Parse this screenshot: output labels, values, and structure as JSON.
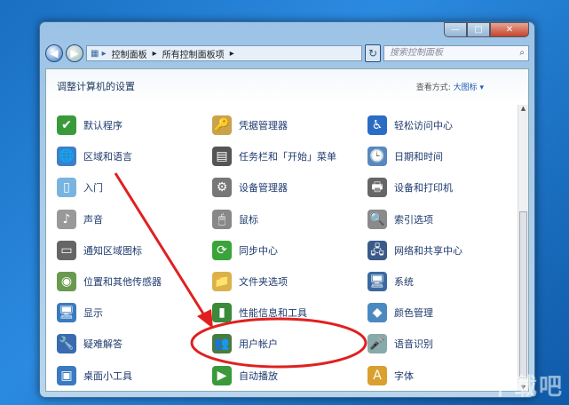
{
  "window": {
    "minimize": "—",
    "maximize": "□",
    "close": "✕"
  },
  "nav": {
    "back": "◀",
    "forward": "▶",
    "breadcrumb": [
      "控制面板",
      "所有控制面板项"
    ],
    "refresh": "↻",
    "search_placeholder": "搜索控制面板"
  },
  "header": {
    "title": "调整计算机的设置",
    "view_label": "查看方式:",
    "view_value": "大图标 ▾"
  },
  "items": [
    {
      "label": "默认程序",
      "icon": "default-programs-icon",
      "color": "#3a9a3a",
      "glyph": "✔"
    },
    {
      "label": "凭据管理器",
      "icon": "credential-manager-icon",
      "color": "#c9a24a",
      "glyph": "🔑"
    },
    {
      "label": "轻松访问中心",
      "icon": "ease-of-access-icon",
      "color": "#2b6cc4",
      "glyph": "♿"
    },
    {
      "label": "区域和语言",
      "icon": "region-language-icon",
      "color": "#3f7ec9",
      "glyph": "🌐"
    },
    {
      "label": "任务栏和「开始」菜单",
      "icon": "taskbar-icon",
      "color": "#555",
      "glyph": "▤"
    },
    {
      "label": "日期和时间",
      "icon": "date-time-icon",
      "color": "#5a86c0",
      "glyph": "🕒"
    },
    {
      "label": "入门",
      "icon": "getting-started-icon",
      "color": "#79b4e0",
      "glyph": "▯"
    },
    {
      "label": "设备管理器",
      "icon": "device-manager-icon",
      "color": "#777",
      "glyph": "⚙"
    },
    {
      "label": "设备和打印机",
      "icon": "devices-printers-icon",
      "color": "#666",
      "glyph": "🖶"
    },
    {
      "label": "声音",
      "icon": "sound-icon",
      "color": "#999",
      "glyph": "♪"
    },
    {
      "label": "鼠标",
      "icon": "mouse-icon",
      "color": "#888",
      "glyph": "🖱"
    },
    {
      "label": "索引选项",
      "icon": "indexing-icon",
      "color": "#8a8a8a",
      "glyph": "🔍"
    },
    {
      "label": "通知区域图标",
      "icon": "notification-icons-icon",
      "color": "#666",
      "glyph": "▭"
    },
    {
      "label": "同步中心",
      "icon": "sync-center-icon",
      "color": "#3aa33a",
      "glyph": "⟳"
    },
    {
      "label": "网络和共享中心",
      "icon": "network-icon",
      "color": "#3a5a8a",
      "glyph": "🖧"
    },
    {
      "label": "位置和其他传感器",
      "icon": "location-sensors-icon",
      "color": "#6a9a50",
      "glyph": "◉"
    },
    {
      "label": "文件夹选项",
      "icon": "folder-options-icon",
      "color": "#d9b24a",
      "glyph": "📁"
    },
    {
      "label": "系统",
      "icon": "system-icon",
      "color": "#3a6aa0",
      "glyph": "🖥"
    },
    {
      "label": "显示",
      "icon": "display-icon",
      "color": "#3a7ac0",
      "glyph": "🖥"
    },
    {
      "label": "性能信息和工具",
      "icon": "performance-icon",
      "color": "#3a8a3a",
      "glyph": "▮"
    },
    {
      "label": "颜色管理",
      "icon": "color-management-icon",
      "color": "#4a8ac0",
      "glyph": "◆"
    },
    {
      "label": "疑难解答",
      "icon": "troubleshooting-icon",
      "color": "#3a6ab0",
      "glyph": "🔧"
    },
    {
      "label": "用户帐户",
      "icon": "user-accounts-icon",
      "color": "#4a7a40",
      "glyph": "👥"
    },
    {
      "label": "语音识别",
      "icon": "speech-recognition-icon",
      "color": "#8aa",
      "glyph": "🎤"
    },
    {
      "label": "桌面小工具",
      "icon": "gadgets-icon",
      "color": "#3a7ac0",
      "glyph": "▣"
    },
    {
      "label": "自动播放",
      "icon": "autoplay-icon",
      "color": "#3a9a3a",
      "glyph": "▶"
    },
    {
      "label": "字体",
      "icon": "fonts-icon",
      "color": "#d9a030",
      "glyph": "A"
    }
  ],
  "watermark": "下载吧",
  "annotation_color": "#e02020"
}
